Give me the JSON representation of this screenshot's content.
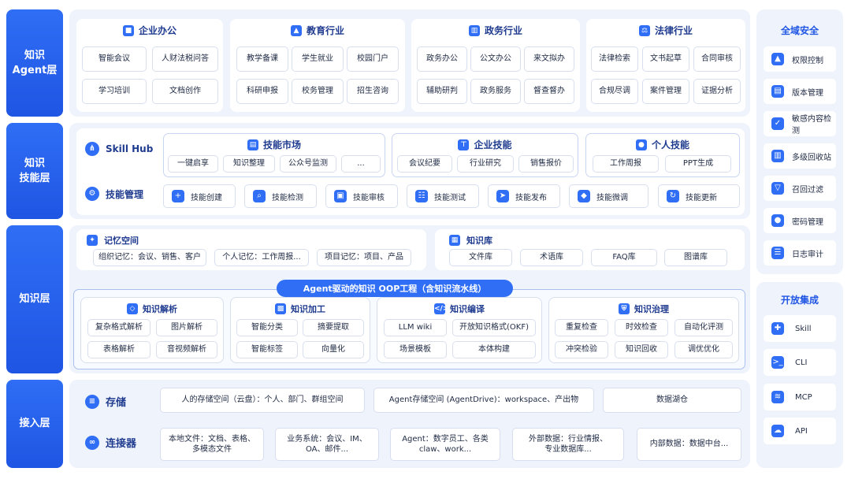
{
  "layers": {
    "agent": "知识\nAgent层",
    "skill": "知识\n技能层",
    "knowledge": "知识层",
    "access": "接入层"
  },
  "agent_layer": {
    "groups": [
      {
        "title": "企业办公",
        "items": [
          "智能会议",
          "人财法税问答",
          "学习培训",
          "文档创作"
        ]
      },
      {
        "title": "教育行业",
        "items": [
          "教学备课",
          "学生就业",
          "校园门户",
          "科研申报",
          "校务管理",
          "招生咨询"
        ]
      },
      {
        "title": "政务行业",
        "items": [
          "政务办公",
          "公文办公",
          "来文拟办",
          "辅助研判",
          "政务服务",
          "督查督办"
        ]
      },
      {
        "title": "法律行业",
        "items": [
          "法律检索",
          "文书起草",
          "合同审核",
          "合规尽调",
          "案件管理",
          "证据分析"
        ]
      }
    ]
  },
  "skill_layer": {
    "hub_label": "Skill Hub",
    "market": {
      "title": "技能市场",
      "items": [
        "一键启享",
        "知识整理",
        "公众号监测",
        "..."
      ]
    },
    "enterprise": {
      "title": "企业技能",
      "items": [
        "会议纪要",
        "行业研究",
        "销售报价"
      ]
    },
    "personal": {
      "title": "个人技能",
      "items": [
        "工作周报",
        "PPT生成"
      ]
    },
    "manage_label": "技能管理",
    "manage_items": [
      "技能创建",
      "技能检测",
      "技能审核",
      "技能测试",
      "技能发布",
      "技能微调",
      "技能更新"
    ]
  },
  "knowledge_layer": {
    "memory": {
      "title": "记忆空间",
      "items": [
        "组织记忆：会议、销售、客户",
        "个人记忆：工作周报...",
        "项目记忆：项目、产品"
      ]
    },
    "kb": {
      "title": "知识库",
      "items": [
        "文件库",
        "术语库",
        "FAQ库",
        "图谱库"
      ]
    },
    "oop_title": "Agent驱动的知识 OOP工程（含知识流水线）",
    "parse": {
      "title": "知识解析",
      "items": [
        "复杂格式解析",
        "图片解析",
        "表格解析",
        "音视频解析"
      ]
    },
    "process": {
      "title": "知识加工",
      "items": [
        "智能分类",
        "摘要提取",
        "智能标签",
        "向量化"
      ]
    },
    "compile": {
      "title": "知识编译",
      "items": [
        "LLM wiki",
        "开放知识格式(OKF)",
        "场景模板",
        "本体构建"
      ]
    },
    "govern": {
      "title": "知识治理",
      "items": [
        "重复检查",
        "时效检查",
        "自动化评测",
        "冲突检验",
        "知识回收",
        "调优优化"
      ]
    }
  },
  "access_layer": {
    "storage_label": "存储",
    "storage_items": [
      "人的存储空间（云盘）：个人、部门、群组空间",
      "Agent存储空间 (AgentDrive)：workspace、产出物",
      "数据湖仓"
    ],
    "connector_label": "连接器",
    "connector_items": [
      "本地文件：文档、表格、\n多模态文件",
      "业务系统：会议、IM、\nOA、邮件...",
      "Agent：数字员工、各类\nclaw、work...",
      "外部数据：行业情报、\n专业数据库...",
      "内部数据：数据中台..."
    ]
  },
  "security": {
    "title": "全域安全",
    "items": [
      "权限控制",
      "版本管理",
      "敏感内容检测",
      "多级回收站",
      "召回过滤",
      "密码管理",
      "日志审计"
    ]
  },
  "integration": {
    "title": "开放集成",
    "items": [
      "Skill",
      "CLI",
      "MCP",
      "API"
    ]
  },
  "colors": {
    "primary": "#2f6ef5",
    "band": "#eef3fc",
    "text": "#1f2a44"
  }
}
